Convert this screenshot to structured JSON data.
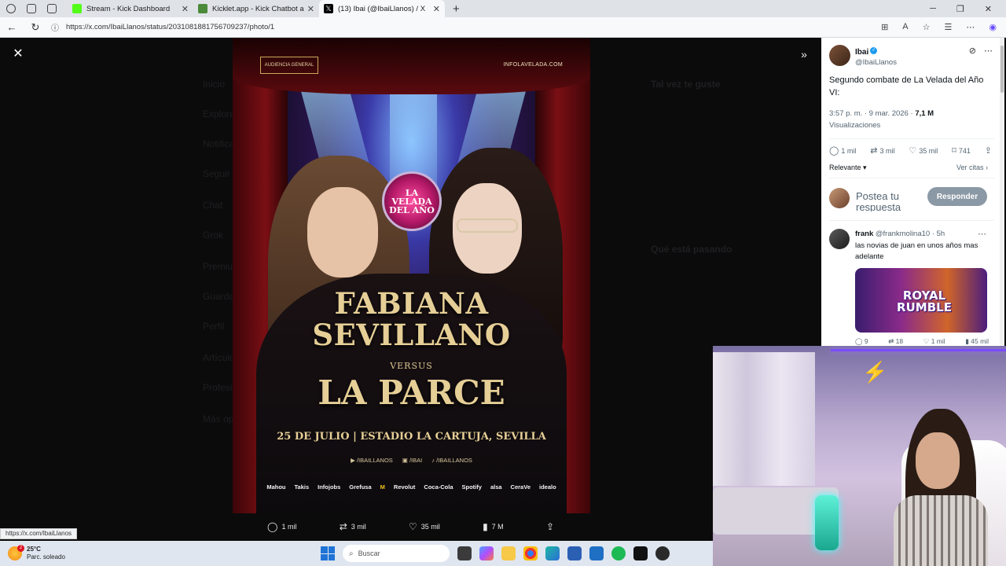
{
  "browser": {
    "tabs": [
      {
        "title": "Stream - Kick Dashboard",
        "favicon_color": "#53fc18",
        "active": false
      },
      {
        "title": "Kicklet.app - Kick Chatbot and O",
        "favicon_color": "#4b8a3a",
        "active": false
      },
      {
        "title": "(13) Ibai (@IbaiLlanos) / X",
        "favicon_color": "#000000",
        "active": true
      }
    ],
    "new_tab": "+",
    "url": "https://x.com/IbaiLlanos/status/2031081881756709237/photo/1"
  },
  "background_nav": [
    "Inicio",
    "Explorar",
    "Notificaciones",
    "Seguir",
    "Chat",
    "Grok",
    "Premium",
    "Guardados",
    "Perfil",
    "Artículos",
    "Profesional",
    "Más opciones"
  ],
  "background_right": {
    "suggest_heading": "Tal vez te guste",
    "trending_heading": "Qué está pasando"
  },
  "poster": {
    "badge": "AUDIENCIA GENERAL",
    "site": "INFOLAVELADA.COM",
    "logo": "LA VELADA DEL AÑO",
    "fighter1_line1": "FABIANA",
    "fighter1_line2": "SEVILLANO",
    "versus": "VERSUS",
    "fighter2": "LA PARCE",
    "date_venue": "25 DE JULIO | ESTADIO LA CARTUJA, SEVILLA",
    "socials": [
      "/IBAILLANOS",
      "/IBAI",
      "/IBAILLANOS"
    ],
    "sponsors": [
      "Mahou",
      "Takis",
      "Infojobs",
      "Grefusa",
      "M",
      "Revolut",
      "Coca-Cola",
      "Spotify",
      "alsa",
      "CeraVe",
      "idealo"
    ]
  },
  "photo_actions": {
    "replies": "1 mil",
    "reposts": "3 mil",
    "likes": "35 mil",
    "views": "7 M"
  },
  "tweet": {
    "author_name": "Ibai",
    "author_handle": "@IbaiLlanos",
    "text": "Segundo combate de La Velada del Año VI:",
    "time_date": "3:57 p. m. · 9 mar. 2026 · ",
    "views_count": "7,1 M",
    "views_label": "Visualizaciones",
    "stats": {
      "replies": "1 mil",
      "reposts": "3 mil",
      "likes": "35 mil",
      "bookmarks": "741"
    },
    "sort_label": "Relevante",
    "quotes_link": "Ver citas",
    "reply_placeholder": "Postea tu respuesta",
    "reply_button": "Responder"
  },
  "reply": {
    "name": "frank",
    "handle": "@frankmolina10",
    "age": "· 5h",
    "text": "las novias de juan en unos años mas adelante",
    "image_text": "ROYAL RUMBLE",
    "stats": {
      "replies": "9",
      "reposts": "18",
      "likes": "1 mil",
      "views": "45 mil"
    }
  },
  "status_url": "https://x.com/IbaiLlanos",
  "taskbar": {
    "weather_temp": "25°C",
    "weather_desc": "Parc. soleado",
    "weather_badge": "2",
    "search_placeholder": "Buscar"
  }
}
